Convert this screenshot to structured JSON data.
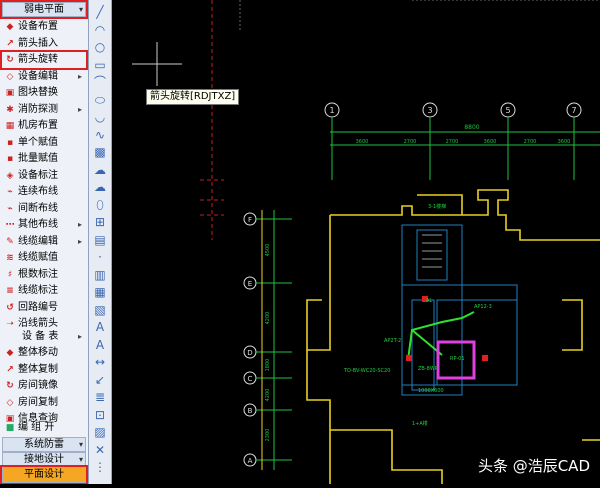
{
  "menu": {
    "top_header": "弱电平面",
    "items": [
      {
        "label": "设备布置",
        "icon": "device-layout-icon"
      },
      {
        "label": "箭头插入",
        "icon": "arrow-insert-icon"
      },
      {
        "label": "箭头旋转",
        "icon": "arrow-rotate-icon"
      },
      {
        "label": "设备编辑",
        "icon": "device-edit-icon",
        "sub": true
      },
      {
        "label": "图块替换",
        "icon": "block-replace-icon"
      },
      {
        "label": "消防探测",
        "icon": "fire-detect-icon",
        "sub": true
      },
      {
        "label": "机房布置",
        "icon": "room-layout-icon"
      },
      {
        "label": "单个赋值",
        "icon": "single-assign-icon"
      },
      {
        "label": "批量赋值",
        "icon": "batch-assign-icon"
      },
      {
        "label": "设备标注",
        "icon": "device-mark-icon"
      },
      {
        "label": "连续布线",
        "icon": "continuous-wiring-icon"
      },
      {
        "label": "间断布线",
        "icon": "gap-wiring-icon"
      },
      {
        "label": "其他布线",
        "icon": "other-wiring-icon",
        "sub": true
      },
      {
        "label": "线缆编辑",
        "icon": "cable-edit-icon",
        "sub": true
      },
      {
        "label": "线缆赋值",
        "icon": "cable-assign-icon"
      },
      {
        "label": "根数标注",
        "icon": "count-mark-icon"
      },
      {
        "label": "线缆标注",
        "icon": "cable-mark-icon"
      },
      {
        "label": "回路编号",
        "icon": "loop-number-icon"
      },
      {
        "label": "沿线箭头",
        "icon": "along-arrow-icon"
      }
    ],
    "section_device_table": "设 备 表",
    "items2": [
      {
        "label": "整体移动",
        "icon": "move-all-icon"
      },
      {
        "label": "整体复制",
        "icon": "copy-all-icon"
      },
      {
        "label": "房间镜像",
        "icon": "room-mirror-icon"
      },
      {
        "label": "房间复制",
        "icon": "room-copy-icon"
      },
      {
        "label": "信息查询",
        "icon": "info-query-icon"
      }
    ],
    "section_group": "编 组 开",
    "bottom_headers": [
      "系统防雷",
      "接地设计"
    ],
    "bottom_selected": "平面设计"
  },
  "tooltip": "箭头旋转[RDJTXZ]",
  "drawing": {
    "axis_top": [
      "1",
      "3",
      "5",
      "7"
    ],
    "dims_top_total": "8800",
    "dims_top": [
      "3600",
      "2700",
      "2700",
      "3600",
      "2700",
      "3600"
    ],
    "axis_left": [
      "F",
      "E",
      "D",
      "C",
      "B",
      "A"
    ],
    "dims_left": [
      "4500",
      "4200",
      "1800",
      "4200",
      "2300"
    ],
    "room_texts": [
      "3-1楼梯",
      "AL",
      "AP2T-2",
      "AP12-3",
      "RP-01",
      "ZB-8WP",
      "1000X600",
      "TO-BV-WC20-SC20",
      "1+A楼"
    ]
  },
  "watermark": "头条 @浩辰CAD",
  "colors": {
    "wall": "#e8d020",
    "axis": "#20c040",
    "highlight": "#e040e0",
    "room": "#2080c0"
  }
}
